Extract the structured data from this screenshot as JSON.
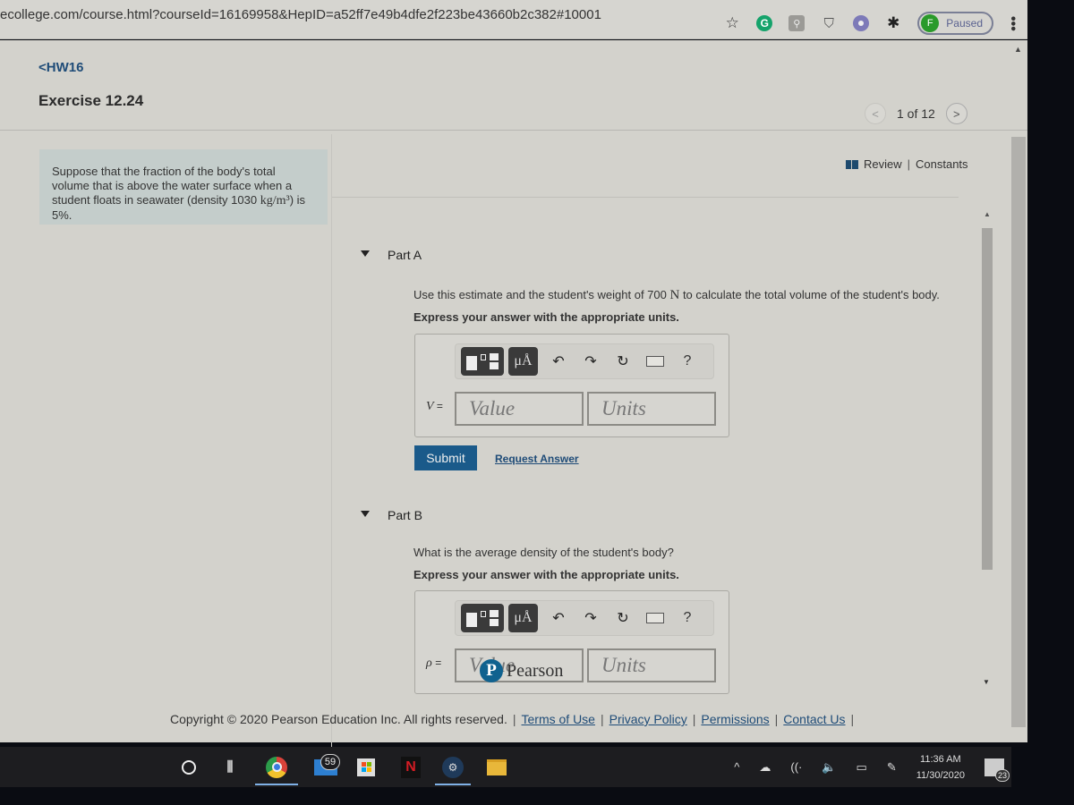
{
  "browser": {
    "url": "ecollege.com/course.html?courseId=16169958&HepID=a52ff7e49b4dfe2f223be43660b2c382#10001",
    "icons": [
      "bookmark-star-icon",
      "grammarly-icon",
      "extension-icon",
      "shield-extension-icon",
      "purple-extension-icon",
      "extensions-puzzle-icon"
    ],
    "profile_initial": "F",
    "profile_status": "Paused",
    "menu_glyph": "⋮"
  },
  "header": {
    "back_link": "HW16",
    "back_chevron": "<",
    "title": "Exercise 12.24",
    "pager": {
      "prev": "<",
      "text": "1 of 12",
      "next": ">"
    }
  },
  "problem": {
    "text_before": "Suppose that the fraction of the body's total volume that is above the water surface when a student floats in seawater (density 1030 ",
    "unit": "kg/m³",
    "text_after": ") is 5%."
  },
  "resources": {
    "review": "Review",
    "separator": "|",
    "constants": "Constants"
  },
  "parts": [
    {
      "label": "Part A",
      "question_before": "Use this estimate and the student's weight of 700 ",
      "question_unit": "N",
      "question_after": " to calculate the total volume of the student's body.",
      "instruction": "Express your answer with the appropriate units.",
      "variable": "V",
      "equals": "=",
      "value_placeholder": "Value",
      "units_placeholder": "Units",
      "submit": "Submit",
      "request_answer": "Request Answer"
    },
    {
      "label": "Part B",
      "question": "What is the average density of the student's body?",
      "instruction": "Express your answer with the appropriate units.",
      "variable": "ρ",
      "equals": "=",
      "value_placeholder": "Value",
      "units_placeholder": "Units"
    }
  ],
  "toolbar": {
    "units_label": "μÅ",
    "undo": "↶",
    "redo": "↷",
    "reset": "↻",
    "help": "?"
  },
  "brand": {
    "logo_letter": "P",
    "name": "Pearson"
  },
  "footer": {
    "copyright": "Copyright © 2020 Pearson Education Inc. All rights reserved.",
    "links": [
      "Terms of Use",
      "Privacy Policy",
      "Permissions",
      "Contact Us"
    ],
    "separator": "|"
  },
  "taskbar": {
    "mail_badge": "59",
    "netflix_letter": "N",
    "time": "11:36 AM",
    "date": "11/30/2020",
    "notification_count": "23",
    "tray_chevron": "^",
    "volume_glyph": "🔈",
    "wifi_glyph": "((·"
  }
}
